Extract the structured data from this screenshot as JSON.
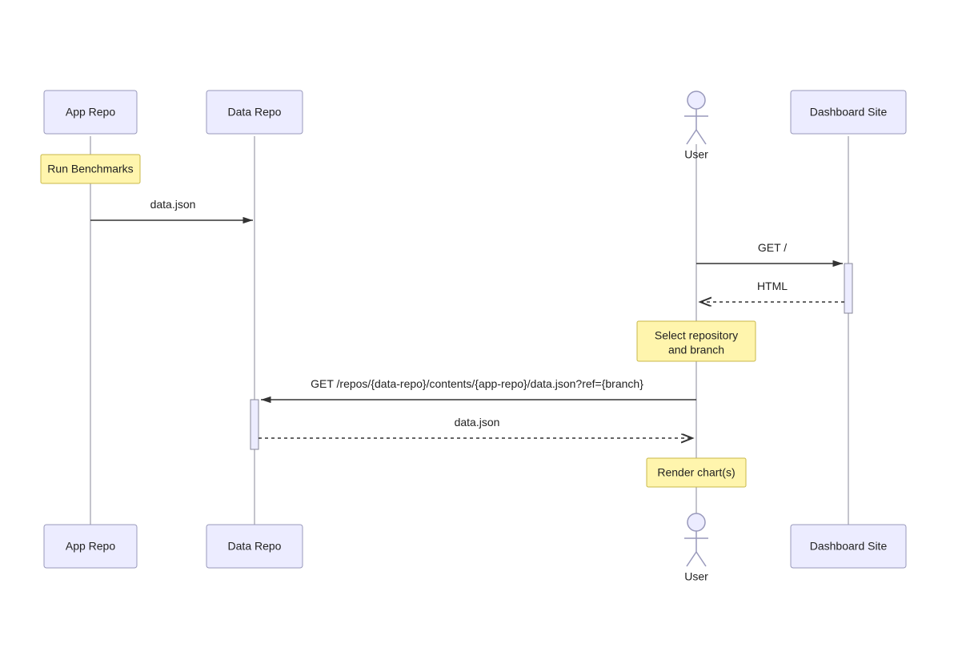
{
  "participants": {
    "app_repo": "App Repo",
    "data_repo": "Data Repo",
    "user": "User",
    "dashboard_site": "Dashboard Site"
  },
  "notes": {
    "run_benchmarks": "Run Benchmarks",
    "select_repo_line1": "Select repository",
    "select_repo_line2": "and branch",
    "render_charts": "Render chart(s)"
  },
  "messages": {
    "data_json_1": "data.json",
    "get_root": "GET /",
    "html": "HTML",
    "get_repos": "GET /repos/{data-repo}/contents/{app-repo}/data.json?ref={branch}",
    "data_json_2": "data.json"
  }
}
